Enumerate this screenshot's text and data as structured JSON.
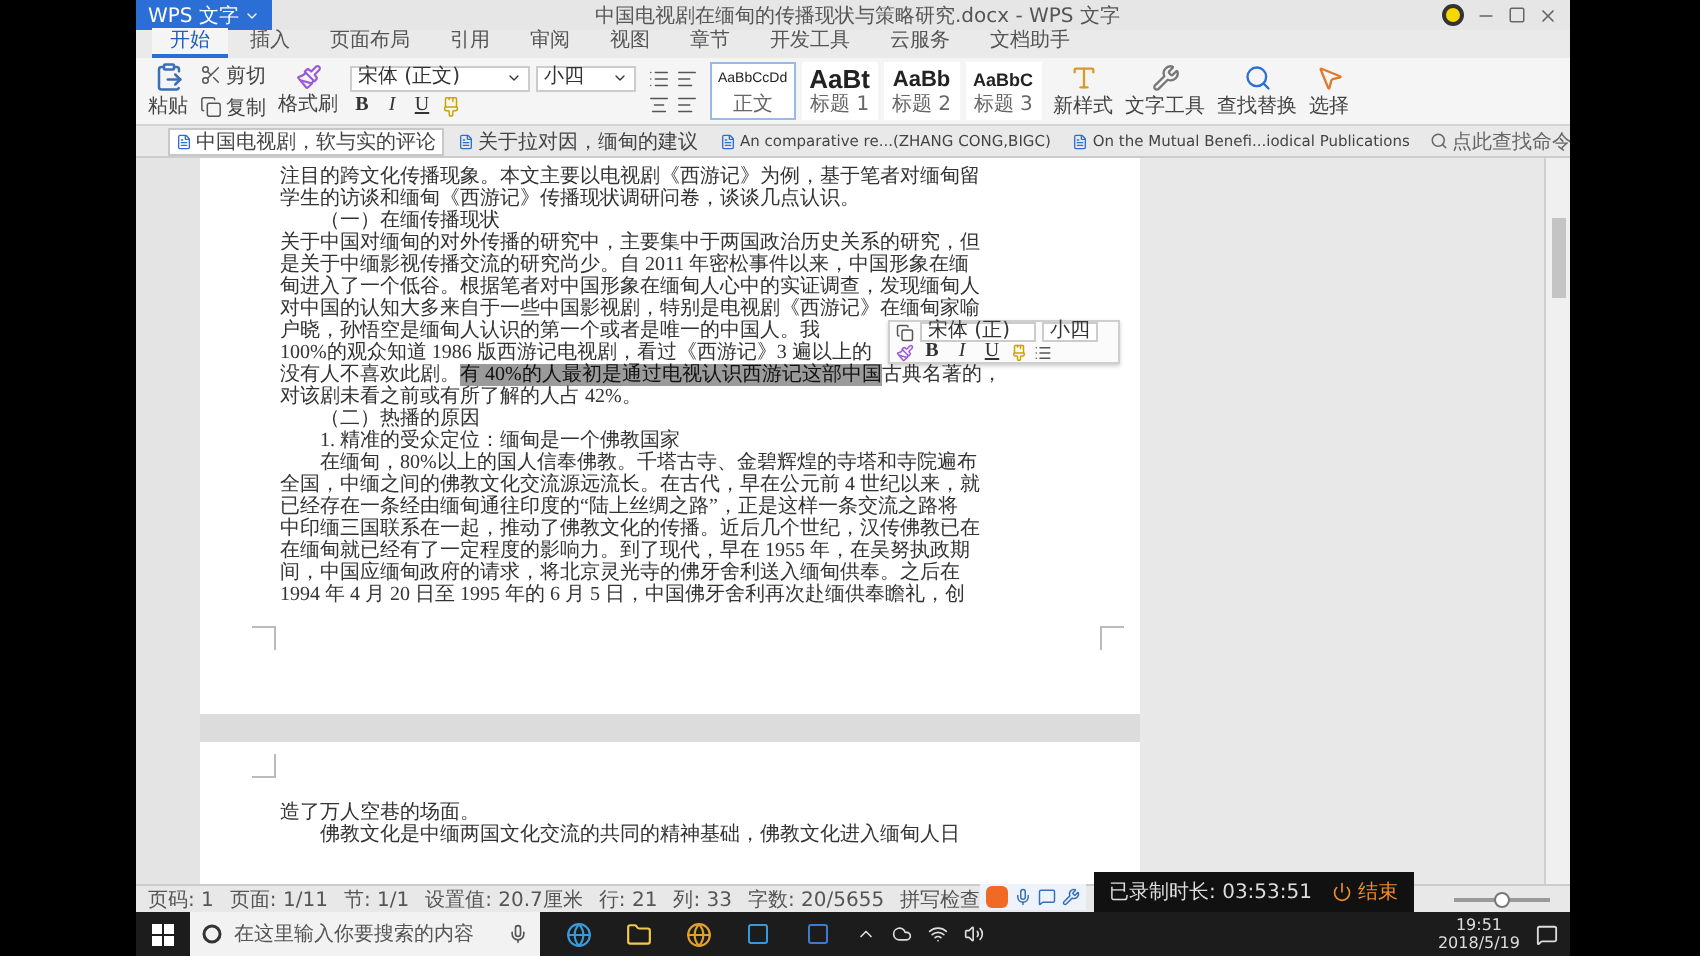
{
  "title_bar": {
    "app": "WPS 文字",
    "title": "中国电视剧在缅甸的传播现状与策略研究.docx - WPS 文字"
  },
  "menu_tabs": [
    {
      "label": "开始",
      "selected": true
    },
    {
      "label": "插入",
      "selected": false
    },
    {
      "label": "页面布局",
      "selected": false
    },
    {
      "label": "引用",
      "selected": false
    },
    {
      "label": "审阅",
      "selected": false
    },
    {
      "label": "视图",
      "selected": false
    },
    {
      "label": "章节",
      "selected": false
    },
    {
      "label": "开发工具",
      "selected": false
    },
    {
      "label": "云服务",
      "selected": false
    },
    {
      "label": "文档助手",
      "selected": false
    }
  ],
  "ribbon": {
    "paste": "粘贴",
    "cut": "剪切",
    "copy": "复制",
    "format_painter": "格式刷",
    "font": "宋体 (正文)",
    "size": "小四",
    "format_buttons": [
      "B",
      "I",
      "U"
    ],
    "styles": [
      {
        "preview": "AaBbCcDd",
        "label": "正文",
        "selected": true
      },
      {
        "preview": "AaBt",
        "label": "标题 1",
        "selected": false
      },
      {
        "preview": "AaBb",
        "label": "标题 2",
        "selected": false
      },
      {
        "preview": "AaBbC",
        "label": "标题 3",
        "selected": false
      }
    ],
    "tools": [
      {
        "label": "新样式",
        "kind": "styles"
      },
      {
        "label": "文字工具",
        "kind": "text"
      },
      {
        "label": "查找替换",
        "kind": "find"
      },
      {
        "label": "选择",
        "kind": "select"
      }
    ]
  },
  "doc_tabs": [
    {
      "label": "中国电视剧，软与实的评论",
      "selected": true
    },
    {
      "label": "关于拉对因，缅甸的建议",
      "selected": false
    },
    {
      "label": "An comparative re...(ZHANG CONG,BIGC)",
      "selected": false
    },
    {
      "label": "On the Mutual Benefi...iodical Publications",
      "selected": false
    }
  ],
  "command_search": {
    "placeholder": "点此查找命令"
  },
  "document": {
    "page_1": [
      {
        "kind": "plain",
        "text": "注目的跨文化传播现象。本文主要以电视剧《西游记》为例，基于笔者对缅甸留"
      },
      {
        "kind": "plain",
        "text": "学生的访谈和缅甸《西游记》传播现状调研问卷，谈谈几点认识。"
      },
      {
        "kind": "indented",
        "text": "（一）在缅传播现状"
      },
      {
        "kind": "plain",
        "text": "关于中国对缅甸的对外传播的研究中，主要集中于两国政治历史关系的研究，但"
      },
      {
        "kind": "plain",
        "text": "是关于中缅影视传播交流的研究尚少。自 2011 年密松事件以来，中国形象在缅"
      },
      {
        "kind": "plain",
        "text": "甸进入了一个低谷。根据笔者对中国形象在缅甸人心中的实证调查，发现缅甸人"
      },
      {
        "kind": "plain",
        "text": "对中国的认知大多来自于一些中国影视剧，特别是电视剧《西游记》在缅甸家喻"
      },
      {
        "kind": "plain",
        "text": "户晓，孙悟空是缅甸人认识的第一个或者是唯一的中国人。我"
      },
      {
        "kind": "plain",
        "text": "100%的观众知道 1986 版西游记电视剧，看过《西游记》3 遍以上的"
      },
      {
        "kind": "plain",
        "text": "没有人不喜欢此剧。",
        "selection": "有 40%的人最初是通过电视认识西游记这部中国",
        "text_after": "古典名著的，"
      },
      {
        "kind": "plain",
        "text": "对该剧未看之前或有所了解的人占 42%。"
      },
      {
        "kind": "indented",
        "text": "（二）热播的原因"
      },
      {
        "kind": "indented",
        "text": "1. 精准的受众定位：缅甸是一个佛教国家"
      },
      {
        "kind": "indented",
        "text": "在缅甸，80%以上的国人信奉佛教。千塔古寺、金碧辉煌的寺塔和寺院遍布"
      },
      {
        "kind": "plain",
        "text": "全国，中缅之间的佛教文化交流源远流长。在古代，早在公元前 4 世纪以来，就"
      },
      {
        "kind": "plain",
        "text": "已经存在一条经由缅甸通往印度的“陆上丝绸之路”，正是这样一条交流之路将"
      },
      {
        "kind": "plain",
        "text": "中印缅三国联系在一起，推动了佛教文化的传播。近后几个世纪，汉传佛教已在"
      },
      {
        "kind": "plain",
        "text": "在缅甸就已经有了一定程度的影响力。到了现代，早在 1955 年，在吴努执政期"
      },
      {
        "kind": "plain",
        "text": "间，中国应缅甸政府的请求，将北京灵光寺的佛牙舍利送入缅甸供奉。之后在"
      },
      {
        "kind": "plain",
        "text": "1994 年 4 月 20 日至 1995 年的 6 月 5 日，中国佛牙舍利再次赴缅供奉瞻礼，创"
      }
    ],
    "page_2": [
      {
        "kind": "plain",
        "text": "造了万人空巷的场面。"
      },
      {
        "kind": "indented",
        "text": "佛教文化是中缅两国文化交流的共同的精神基础，佛教文化进入缅甸人日"
      }
    ]
  },
  "mini_toolbar": {
    "font": "宋体 (正)",
    "size": "小四",
    "format_buttons": [
      "B",
      "I",
      "U"
    ]
  },
  "status_bar": {
    "items": [
      "页码: 1",
      "页面: 1/11",
      "节: 1/1",
      "设置值: 20.7厘米",
      "行: 21",
      "列: 33",
      "字数: 20/5655",
      "拼写检查"
    ],
    "zoom": {
      "level": 0.5
    }
  },
  "recorder": {
    "elapsed": "已录制时长: 03:53:51",
    "stop": "结束"
  },
  "taskbar": {
    "search": {
      "placeholder": "在这里输入你要搜索的内容"
    },
    "time": "19:51",
    "date": "2018/5/19"
  }
}
